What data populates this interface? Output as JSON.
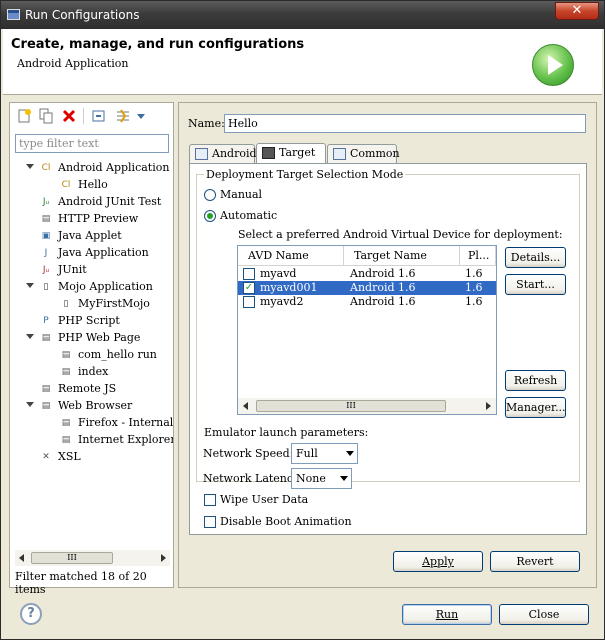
{
  "window": {
    "title": "Run Configurations",
    "close_glyph": "✕"
  },
  "header": {
    "title": "Create, manage, and run configurations",
    "subtitle": "Android Application"
  },
  "left": {
    "filter_placeholder": "type filter text",
    "tree": [
      {
        "label": "Android Application",
        "icon": "android-app-icon",
        "glyph": "Cl",
        "color": "#b8860b",
        "indent": 0,
        "expanded": true
      },
      {
        "label": "Hello",
        "icon": "android-config-icon",
        "glyph": "Cl",
        "color": "#b8860b",
        "indent": 1
      },
      {
        "label": "Android JUnit Test",
        "icon": "junit-icon",
        "glyph": "Jᵤ",
        "color": "#2d7a2d",
        "indent": 0
      },
      {
        "label": "HTTP Preview",
        "icon": "http-preview-icon",
        "glyph": "▤",
        "color": "#555",
        "indent": 0
      },
      {
        "label": "Java Applet",
        "icon": "java-applet-icon",
        "glyph": "▣",
        "color": "#3a6ea5",
        "indent": 0
      },
      {
        "label": "Java Application",
        "icon": "java-app-icon",
        "glyph": "J",
        "color": "#3a6ea5",
        "indent": 0
      },
      {
        "label": "JUnit",
        "icon": "junit-icon",
        "glyph": "Jᵤ",
        "color": "#b03030",
        "indent": 0
      },
      {
        "label": "Mojo Application",
        "icon": "mojo-app-icon",
        "glyph": "▯",
        "color": "#333",
        "indent": 0,
        "expanded": true
      },
      {
        "label": "MyFirstMojo",
        "icon": "mojo-config-icon",
        "glyph": "▯",
        "color": "#333",
        "indent": 1
      },
      {
        "label": "PHP Script",
        "icon": "php-script-icon",
        "glyph": "P",
        "color": "#3a6ea5",
        "indent": 0
      },
      {
        "label": "PHP Web Page",
        "icon": "php-web-icon",
        "glyph": "▤",
        "color": "#555",
        "indent": 0,
        "expanded": true
      },
      {
        "label": "com_hello run",
        "icon": "php-config-icon",
        "glyph": "▤",
        "color": "#555",
        "indent": 1
      },
      {
        "label": "index",
        "icon": "php-config-icon",
        "glyph": "▤",
        "color": "#555",
        "indent": 1
      },
      {
        "label": "Remote JS",
        "icon": "remote-js-icon",
        "glyph": "▤",
        "color": "#555",
        "indent": 0
      },
      {
        "label": "Web Browser",
        "icon": "web-browser-icon",
        "glyph": "▤",
        "color": "#555",
        "indent": 0,
        "expanded": true
      },
      {
        "label": "Firefox - Internal Se",
        "icon": "browser-config-icon",
        "glyph": "▤",
        "color": "#555",
        "indent": 1
      },
      {
        "label": "Internet Explorer - I",
        "icon": "browser-config-icon",
        "glyph": "▤",
        "color": "#555",
        "indent": 1
      },
      {
        "label": "XSL",
        "icon": "xsl-icon",
        "glyph": "✕",
        "color": "#555",
        "indent": 0
      }
    ],
    "scroll_grip": "III",
    "status": "Filter matched 18 of 20 items"
  },
  "right": {
    "name_label": "Name:",
    "name_value": "Hello",
    "tabs": [
      {
        "label": "Android",
        "selected": false
      },
      {
        "label": "Target",
        "selected": true
      },
      {
        "label": "Common",
        "selected": false
      }
    ],
    "deployment_group": "Deployment Target Selection Mode",
    "manual": "Manual",
    "automatic": "Automatic",
    "avd_prompt": "Select a preferred Android Virtual Device for deployment:",
    "table": {
      "headers": [
        "AVD Name",
        "Target Name",
        "Pl..."
      ],
      "rows": [
        {
          "name": "myavd",
          "target": "Android 1.6",
          "platform": "1.6",
          "checked": false,
          "selected": false
        },
        {
          "name": "myavd001",
          "target": "Android 1.6",
          "platform": "1.6",
          "checked": true,
          "selected": true
        },
        {
          "name": "myavd2",
          "target": "Android 1.6",
          "platform": "1.6",
          "checked": false,
          "selected": false
        }
      ]
    },
    "buttons": {
      "details": "Details...",
      "start": "Start...",
      "refresh": "Refresh",
      "manager": "Manager..."
    },
    "emulator_group": "Emulator launch parameters:",
    "network_speed_label": "Network Speed:",
    "network_speed_value": "Full",
    "network_latency_label": "Network Latency:",
    "network_latency_value": "None",
    "wipe_user_data": "Wipe User Data",
    "disable_boot_animation": "Disable Boot Animation",
    "apply": "Apply",
    "revert": "Revert"
  },
  "footer": {
    "run": "Run",
    "close": "Close",
    "help_glyph": "?"
  },
  "colors": {
    "selection": "#316ac5",
    "titlebar": "#3c3c3c",
    "dialog_bg": "#ece9d8"
  }
}
